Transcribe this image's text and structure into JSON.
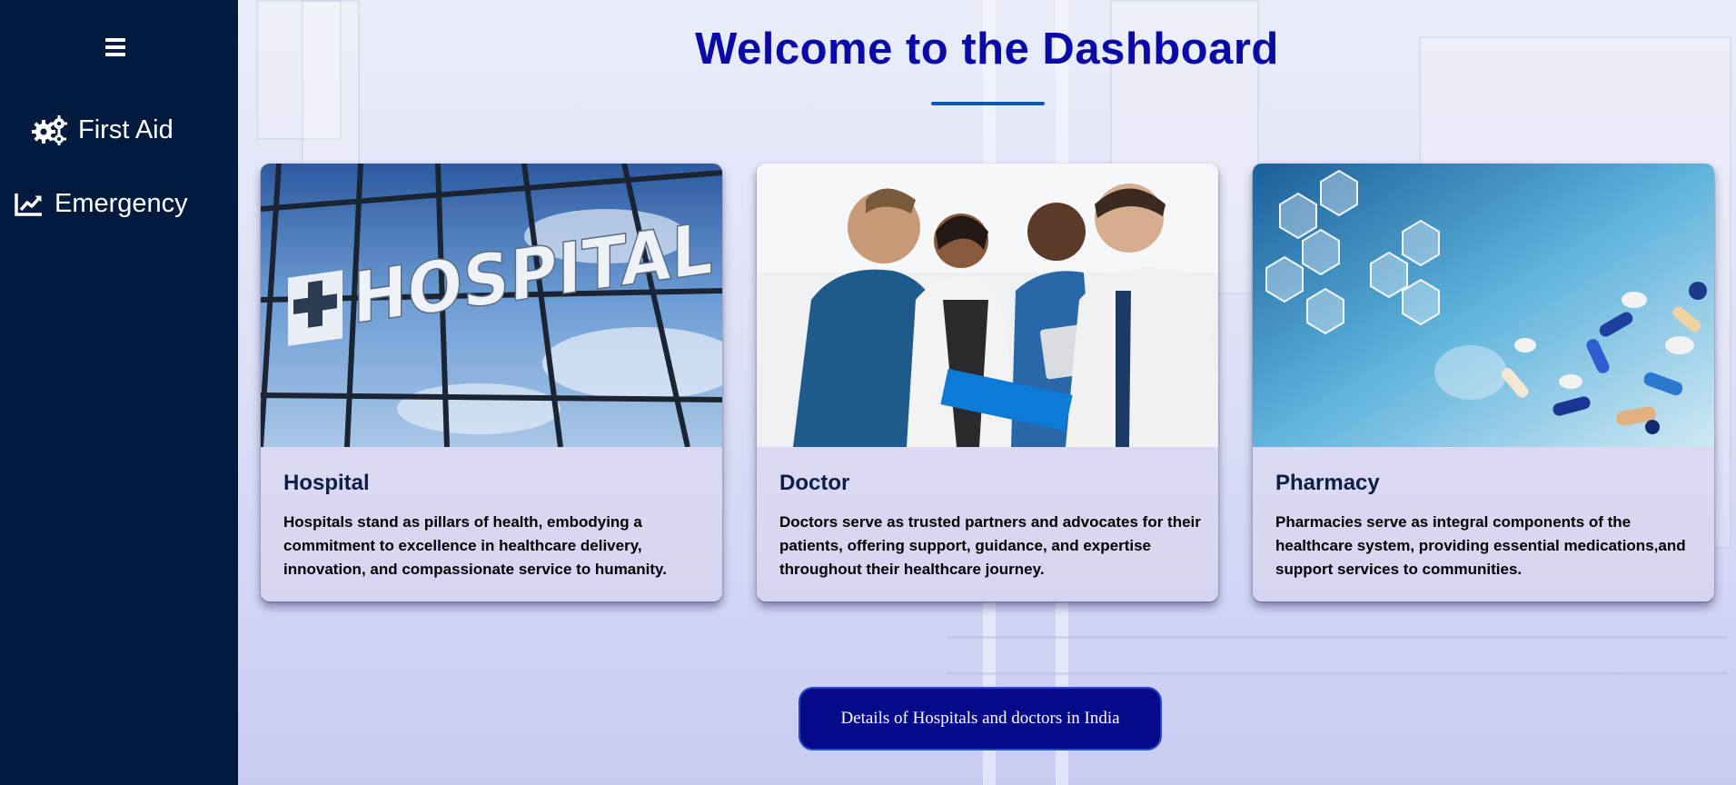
{
  "sidebar": {
    "menu_icon": "hamburger-icon",
    "items": [
      {
        "label": "First Aid",
        "icon": "gears-icon"
      },
      {
        "label": "Emergency",
        "icon": "line-chart-icon"
      }
    ]
  },
  "page": {
    "title": "Welcome to the Dashboard"
  },
  "cards": [
    {
      "title": "Hospital",
      "text": "Hospitals stand as pillars of health, embodying a commitment to excellence in healthcare delivery, innovation, and compassionate service to humanity.",
      "image_sign": "HOSPITAL"
    },
    {
      "title": "Doctor",
      "text": "Doctors serve as trusted partners and advocates for their patients, offering support, guidance, and expertise throughout their healthcare journey."
    },
    {
      "title": "Pharmacy",
      "text": "Pharmacies serve as integral components of the healthcare system, providing essential medications,and support services to communities."
    }
  ],
  "cta": {
    "label": "Details of Hospitals and doctors in India"
  },
  "colors": {
    "sidebar": "#021a3d",
    "title": "#0a0aa8",
    "underline": "#0b56b8",
    "cta_bg": "#050a88",
    "cta_border": "#2749c9"
  }
}
